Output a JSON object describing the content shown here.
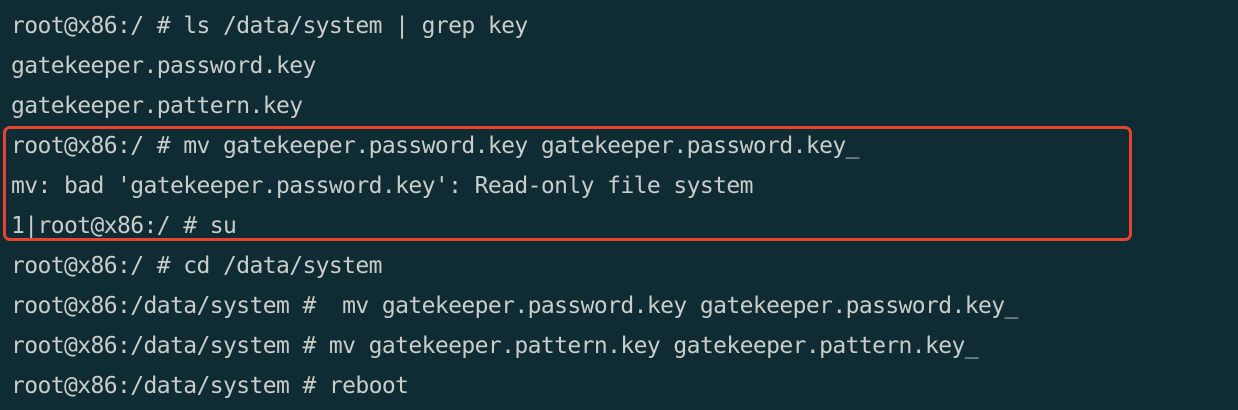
{
  "terminal": {
    "lines": [
      "root@x86:/ # ls /data/system | grep key",
      "gatekeeper.password.key",
      "gatekeeper.pattern.key",
      "root@x86:/ # mv gatekeeper.password.key gatekeeper.password.key_",
      "mv: bad 'gatekeeper.password.key': Read-only file system",
      "1|root@x86:/ # su",
      "root@x86:/ # cd /data/system",
      "root@x86:/data/system #  mv gatekeeper.password.key gatekeeper.password.key_",
      "root@x86:/data/system # mv gatekeeper.pattern.key gatekeeper.pattern.key_",
      "root@x86:/data/system # reboot"
    ]
  },
  "colors": {
    "background": "#0f2b33",
    "text": "#c9ccc8",
    "highlight_border": "#e8432f"
  }
}
